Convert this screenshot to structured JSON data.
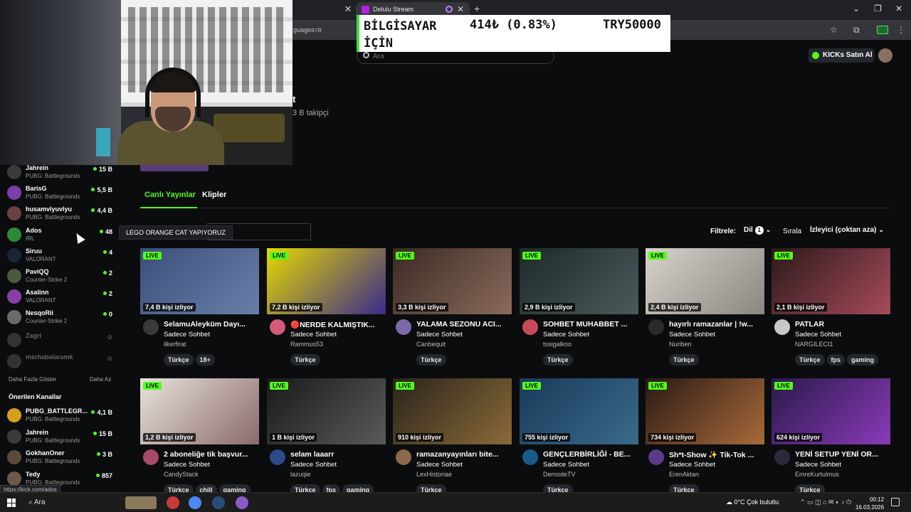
{
  "browser": {
    "tab_title": "Delulu Stream",
    "url_fragment": "guages=tr",
    "status_url": "https://kick.com/ados"
  },
  "price_banner": {
    "name": "BİLGİSAYAR İÇİN",
    "change": "414₺ (0.83%)",
    "target": "TRY50000"
  },
  "header": {
    "search_placeholder": "Ara",
    "kicks_button": "KICKs Satın Al"
  },
  "channel": {
    "name_fragment": "t",
    "followers": "3 B takipçi"
  },
  "content_tabs": [
    "Canlı Yayınlar",
    "Klipler"
  ],
  "tooltip": "LEGO ORANGE CAT YAPIYORUZ",
  "filters": {
    "label": "Filtrele:",
    "language": "Dil",
    "language_count": "1",
    "sort_label": "Sırala",
    "sort_value": "İzleyici (çoktan aza)"
  },
  "sidebar": {
    "following": [
      {
        "name": "Jahrein",
        "game": "PUBG: Battlegrounds",
        "count": "15 B",
        "avatar": "#3a3a3a"
      },
      {
        "name": "BarisG",
        "game": "PUBG: Battlegrounds",
        "count": "5,5 B",
        "avatar": "#7a3fa8"
      },
      {
        "name": "husamvlyuvlyu",
        "game": "PUBG: Battlegrounds",
        "count": "4,4 B",
        "avatar": "#6a4040"
      },
      {
        "name": "Ados",
        "game": "IRL",
        "count": "48",
        "avatar": "#2d8a3a"
      },
      {
        "name": "Siruu",
        "game": "VALORANT",
        "count": "4",
        "avatar": "#1b2436"
      },
      {
        "name": "PaviQQ",
        "game": "Counter-Strike 2",
        "count": "2",
        "avatar": "#4a5a3a"
      },
      {
        "name": "Asalinn",
        "game": "VALORANT",
        "count": "2",
        "avatar": "#8a3fa8"
      },
      {
        "name": "NesqoRii",
        "game": "Counter-Strike 2",
        "count": "0",
        "avatar": "#6a6a6a"
      }
    ],
    "offline": [
      {
        "name": "Zagri",
        "avatar": "#333"
      },
      {
        "name": "merhabalaramk",
        "avatar": "#333"
      }
    ],
    "show_more": "Daha Fazla Göster",
    "show_less": "Daha Az",
    "recommended_title": "Önerilen Kanallar",
    "recommended": [
      {
        "name": "PUBG_BATTLEGR...",
        "game": "PUBG: Battlegrounds",
        "count": "4,1 B",
        "avatar": "#d4a017"
      },
      {
        "name": "Jahrein",
        "game": "PUBG: Battlegrounds",
        "count": "15 B",
        "avatar": "#3a3a3a"
      },
      {
        "name": "GokhanOner",
        "game": "PUBG: Battlegrounds",
        "count": "3 B",
        "avatar": "#5a4a3a"
      },
      {
        "name": "Tedy",
        "game": "PUBG: Battlegrounds",
        "count": "857",
        "avatar": "#6a5a4a"
      }
    ]
  },
  "streams": [
    {
      "live": "LIVE",
      "viewers": "7,4 B kişi izliyor",
      "title": "SelamuAleyküm Dayı...",
      "category": "Sadece Sohbet",
      "user": "ilkerfirat",
      "tags": [
        "Türkçe",
        "18+"
      ],
      "thumb": [
        "#3a4f7a",
        "#6a7fa8"
      ],
      "avatar": "#3a3a3a"
    },
    {
      "live": "LIVE",
      "viewers": "7,2 B kişi izliyor",
      "title": "🔴NERDE KALMIŞTIK...",
      "category": "Sadece Sohbet",
      "user": "Rammus53",
      "tags": [
        "Türkçe"
      ],
      "thumb": [
        "#e6d800",
        "#3a2a8a"
      ],
      "avatar": "#d45a7a"
    },
    {
      "live": "LIVE",
      "viewers": "3,3 B kişi izliyor",
      "title": "YALAMA SEZONU ACI...",
      "category": "Sadece Sohbet",
      "user": "Canbequit",
      "tags": [
        "Türkçe"
      ],
      "thumb": [
        "#3a2a24",
        "#8a6a5a"
      ],
      "avatar": "#7a6aa8"
    },
    {
      "live": "LIVE",
      "viewers": "2,9 B kişi izliyor",
      "title": "SOHBET MUHABBET ...",
      "category": "Sadece Sohbet",
      "user": "tssigalkoo",
      "tags": [
        "Türkçe"
      ],
      "thumb": [
        "#1e2a2a",
        "#4a5a5a"
      ],
      "avatar": "#c84a5a"
    },
    {
      "live": "LIVE",
      "viewers": "2,4 B kişi izliyor",
      "title": "hayırlı ramazanlar | !w...",
      "category": "Sadece Sohbet",
      "user": "Nuriben",
      "tags": [
        "Türkçe"
      ],
      "thumb": [
        "#d8d4cc",
        "#8a8680"
      ],
      "avatar": "#2a2a2a"
    },
    {
      "live": "LIVE",
      "viewers": "2,1 B kişi izliyor",
      "title": "PATLAR",
      "category": "Sadece Sohbet",
      "user": "NARGILECI1",
      "tags": [
        "Türkçe",
        "fps",
        "gaming"
      ],
      "thumb": [
        "#2a1a1a",
        "#a84a5a"
      ],
      "avatar": "#c8c8c8"
    },
    {
      "live": "LIVE",
      "viewers": "1,2 B kişi izliyor",
      "title": "2 aboneliğe tik başvur...",
      "category": "Sadece Sohbet",
      "user": "CandyStack",
      "tags": [
        "Türkçe",
        "chill",
        "gaming"
      ],
      "thumb": [
        "#e8e4dc",
        "#8a6a6a"
      ],
      "avatar": "#a84a6a"
    },
    {
      "live": "LIVE",
      "viewers": "1 B kişi izliyor",
      "title": "selam laaarr",
      "category": "Sadece Sohbet",
      "user": "lazuqie",
      "tags": [
        "Türkçe",
        "fps",
        "gaming"
      ],
      "thumb": [
        "#1a1a1a",
        "#5a5a5a"
      ],
      "avatar": "#2a4a8a"
    },
    {
      "live": "LIVE",
      "viewers": "910 kişi izliyor",
      "title": "ramazanyayınları bite...",
      "category": "Sadece Sohbet",
      "user": "LexHistoriae",
      "tags": [
        "Türkçe"
      ],
      "thumb": [
        "#2a241a",
        "#8a6a3a"
      ],
      "avatar": "#8a6a4a"
    },
    {
      "live": "LIVE",
      "viewers": "755 kişi izliyor",
      "title": "GENÇLERBİRLİĞİ - BE...",
      "category": "Sadece Sohbet",
      "user": "DemodeTV",
      "tags": [
        "Türkçe"
      ],
      "thumb": [
        "#1a3a5a",
        "#3a6a8a"
      ],
      "avatar": "#1a5a8a"
    },
    {
      "live": "LIVE",
      "viewers": "734 kişi izliyor",
      "title": "Sh*t-Show ✨ Tik-Tok ...",
      "category": "Sadece Sohbet",
      "user": "ErenAktan",
      "tags": [
        "Türkçe"
      ],
      "thumb": [
        "#2a1a14",
        "#a86a3a"
      ],
      "avatar": "#5a3a8a"
    },
    {
      "live": "LIVE",
      "viewers": "624 kişi izliyor",
      "title": "YENİ SETUP YENİ OR...",
      "category": "Sadece Sohbet",
      "user": "EmreKurtulmus",
      "tags": [
        "Türkçe"
      ],
      "thumb": [
        "#2a1a4a",
        "#8a3ab8"
      ],
      "avatar": "#2a2a3a"
    }
  ],
  "taskbar": {
    "search": "Ara",
    "weather": "0°C  Çok bulutlu",
    "time": "00:12",
    "date": "16.03.2026"
  }
}
